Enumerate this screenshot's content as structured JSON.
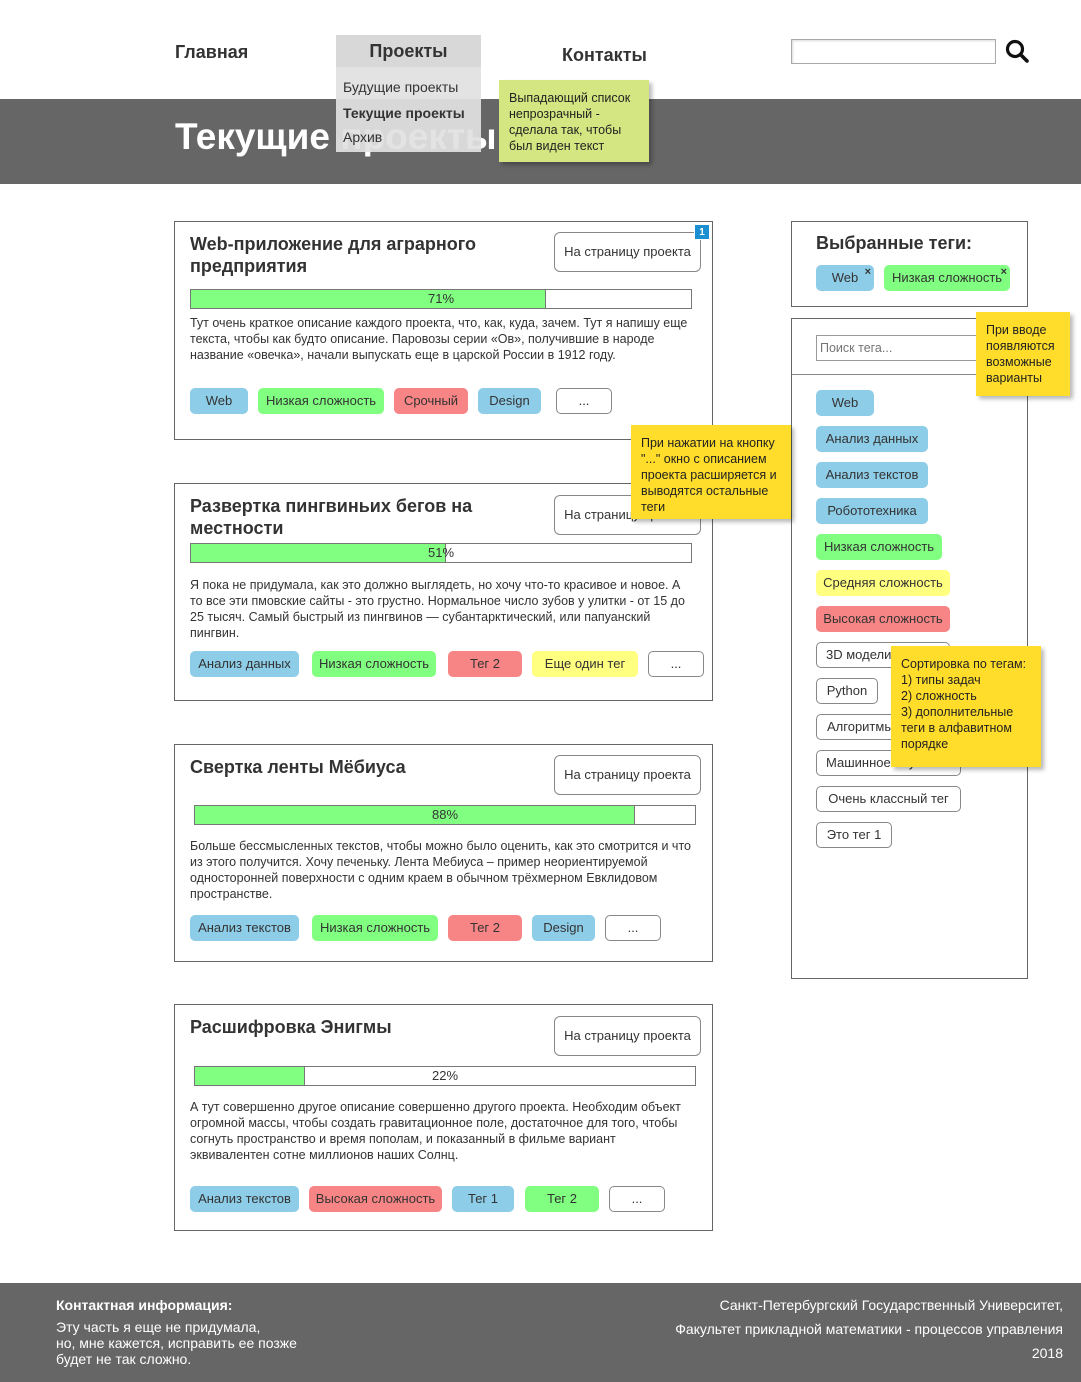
{
  "nav": {
    "home": "Главная",
    "projects": "Проекты",
    "contacts": "Контакты",
    "search_value": "",
    "dropdown": [
      "Будущие проекты",
      "Текущие проекты",
      "Архив"
    ]
  },
  "banner": {
    "title": "Текущие проекты"
  },
  "notes": {
    "dropdown": "Выпадающий список непрозрачный - сделала так, чтобы был виден текст",
    "more_button": "При нажатии на кнопку \"...\" окно с описанием проекта расширяется и выводятся остальные теги",
    "search_hint": "При вводе появляются возможные варианты",
    "sorting": "Сортировка по тегам:\n1) типы задач\n2) сложность\n3) дополнительные теги в алфавитном порядке"
  },
  "projects": [
    {
      "title": "Web-приложение для аграрного предприятия",
      "button": "На страницу проекта",
      "badge": "1",
      "progress": 71,
      "progress_label": "71%",
      "description": "Тут очень краткое описание каждого проекта, что, как, куда, зачем. Тут я напишу еще текста, чтобы как будто описание. Паровозы серии «Ов», получившие в народе название «овечка», начали выпускать еще в царской России в 1912 году.",
      "tags": [
        "Web",
        "Низкая сложность",
        "Срочный",
        "Design"
      ],
      "more": "..."
    },
    {
      "title": "Развертка пингвиньих бегов на местности",
      "button": "На страницу проекта",
      "progress": 51,
      "progress_label": "51%",
      "description": "Я пока не придумала, как это должно выглядеть, но хочу что-то красивое и новое. А то все эти пмовские сайты - это грустно. Нормальное число зубов у улитки - от 15 до 25 тысяч. Самый быстрый из пингвинов — субантарктический, или папуанский пингвин.",
      "tags": [
        "Анализ данных",
        "Низкая сложность",
        "Тег 2",
        "Еще один тег"
      ],
      "more": "..."
    },
    {
      "title": "Свертка ленты Мёбиуса",
      "button": "На страницу проекта",
      "progress": 88,
      "progress_label": "88%",
      "description": "Больше бессмысленных текстов, чтобы можно было оценить, как это смотрится и что из этого получится. Хочу печеньку. Лента Мебиуса – пример неориентируемой односторонней поверхности с одним краем в обычном трёхмерном Евклидовом пространстве.",
      "tags": [
        "Анализ текстов",
        "Низкая сложность",
        "Тег 2",
        "Design"
      ],
      "more": "..."
    },
    {
      "title": "Расшифровка Энигмы",
      "button": "На страницу проекта",
      "progress": 22,
      "progress_label": "22%",
      "description": "А тут совершенно другое описание совершенно другого проекта. Необходим объект огромной массы, чтобы создать гравитационное поле, достаточное для того, чтобы согнуть пространство и время пополам, и показанный в фильме вариант эквивалентен сотне миллионов наших Солнц.",
      "tags": [
        "Анализ текстов",
        "Высокая сложность",
        "Тег 1",
        "Тег 2"
      ],
      "more": "..."
    }
  ],
  "selected_tags": {
    "heading": "Выбранные теги:",
    "tags": [
      "Web",
      "Низкая сложность"
    ],
    "remove_icon": "×"
  },
  "tag_list": {
    "search_placeholder": "Поиск тега...",
    "tags": [
      "Web",
      "Анализ данных",
      "Анализ текстов",
      "Робототехника",
      "Низкая сложность",
      "Средняя сложность",
      "Высокая сложность",
      "3D моделирование",
      "Python",
      "Алгоритмы",
      "Машинное обучение",
      "Очень классный тег",
      "Это тег 1"
    ]
  },
  "colors": {
    "blue_tag": "#8ecde8",
    "green_tag": "#80ff80",
    "red_tag": "#f88585",
    "yellow_tag": "#ffff80",
    "banner": "#666666",
    "sticky_yellow": "#ffdd2a",
    "sticky_green": "#d4e681"
  },
  "footer": {
    "heading": "Контактная информация:",
    "text": "Эту часть я еще не придумала,\nно, мне кажется, исправить ее позже\nбудет не так сложно.",
    "university": "Санкт-Петербургский Государственный Университет,",
    "faculty": "Факультет прикладной математики - процессов управления",
    "year": "2018"
  }
}
